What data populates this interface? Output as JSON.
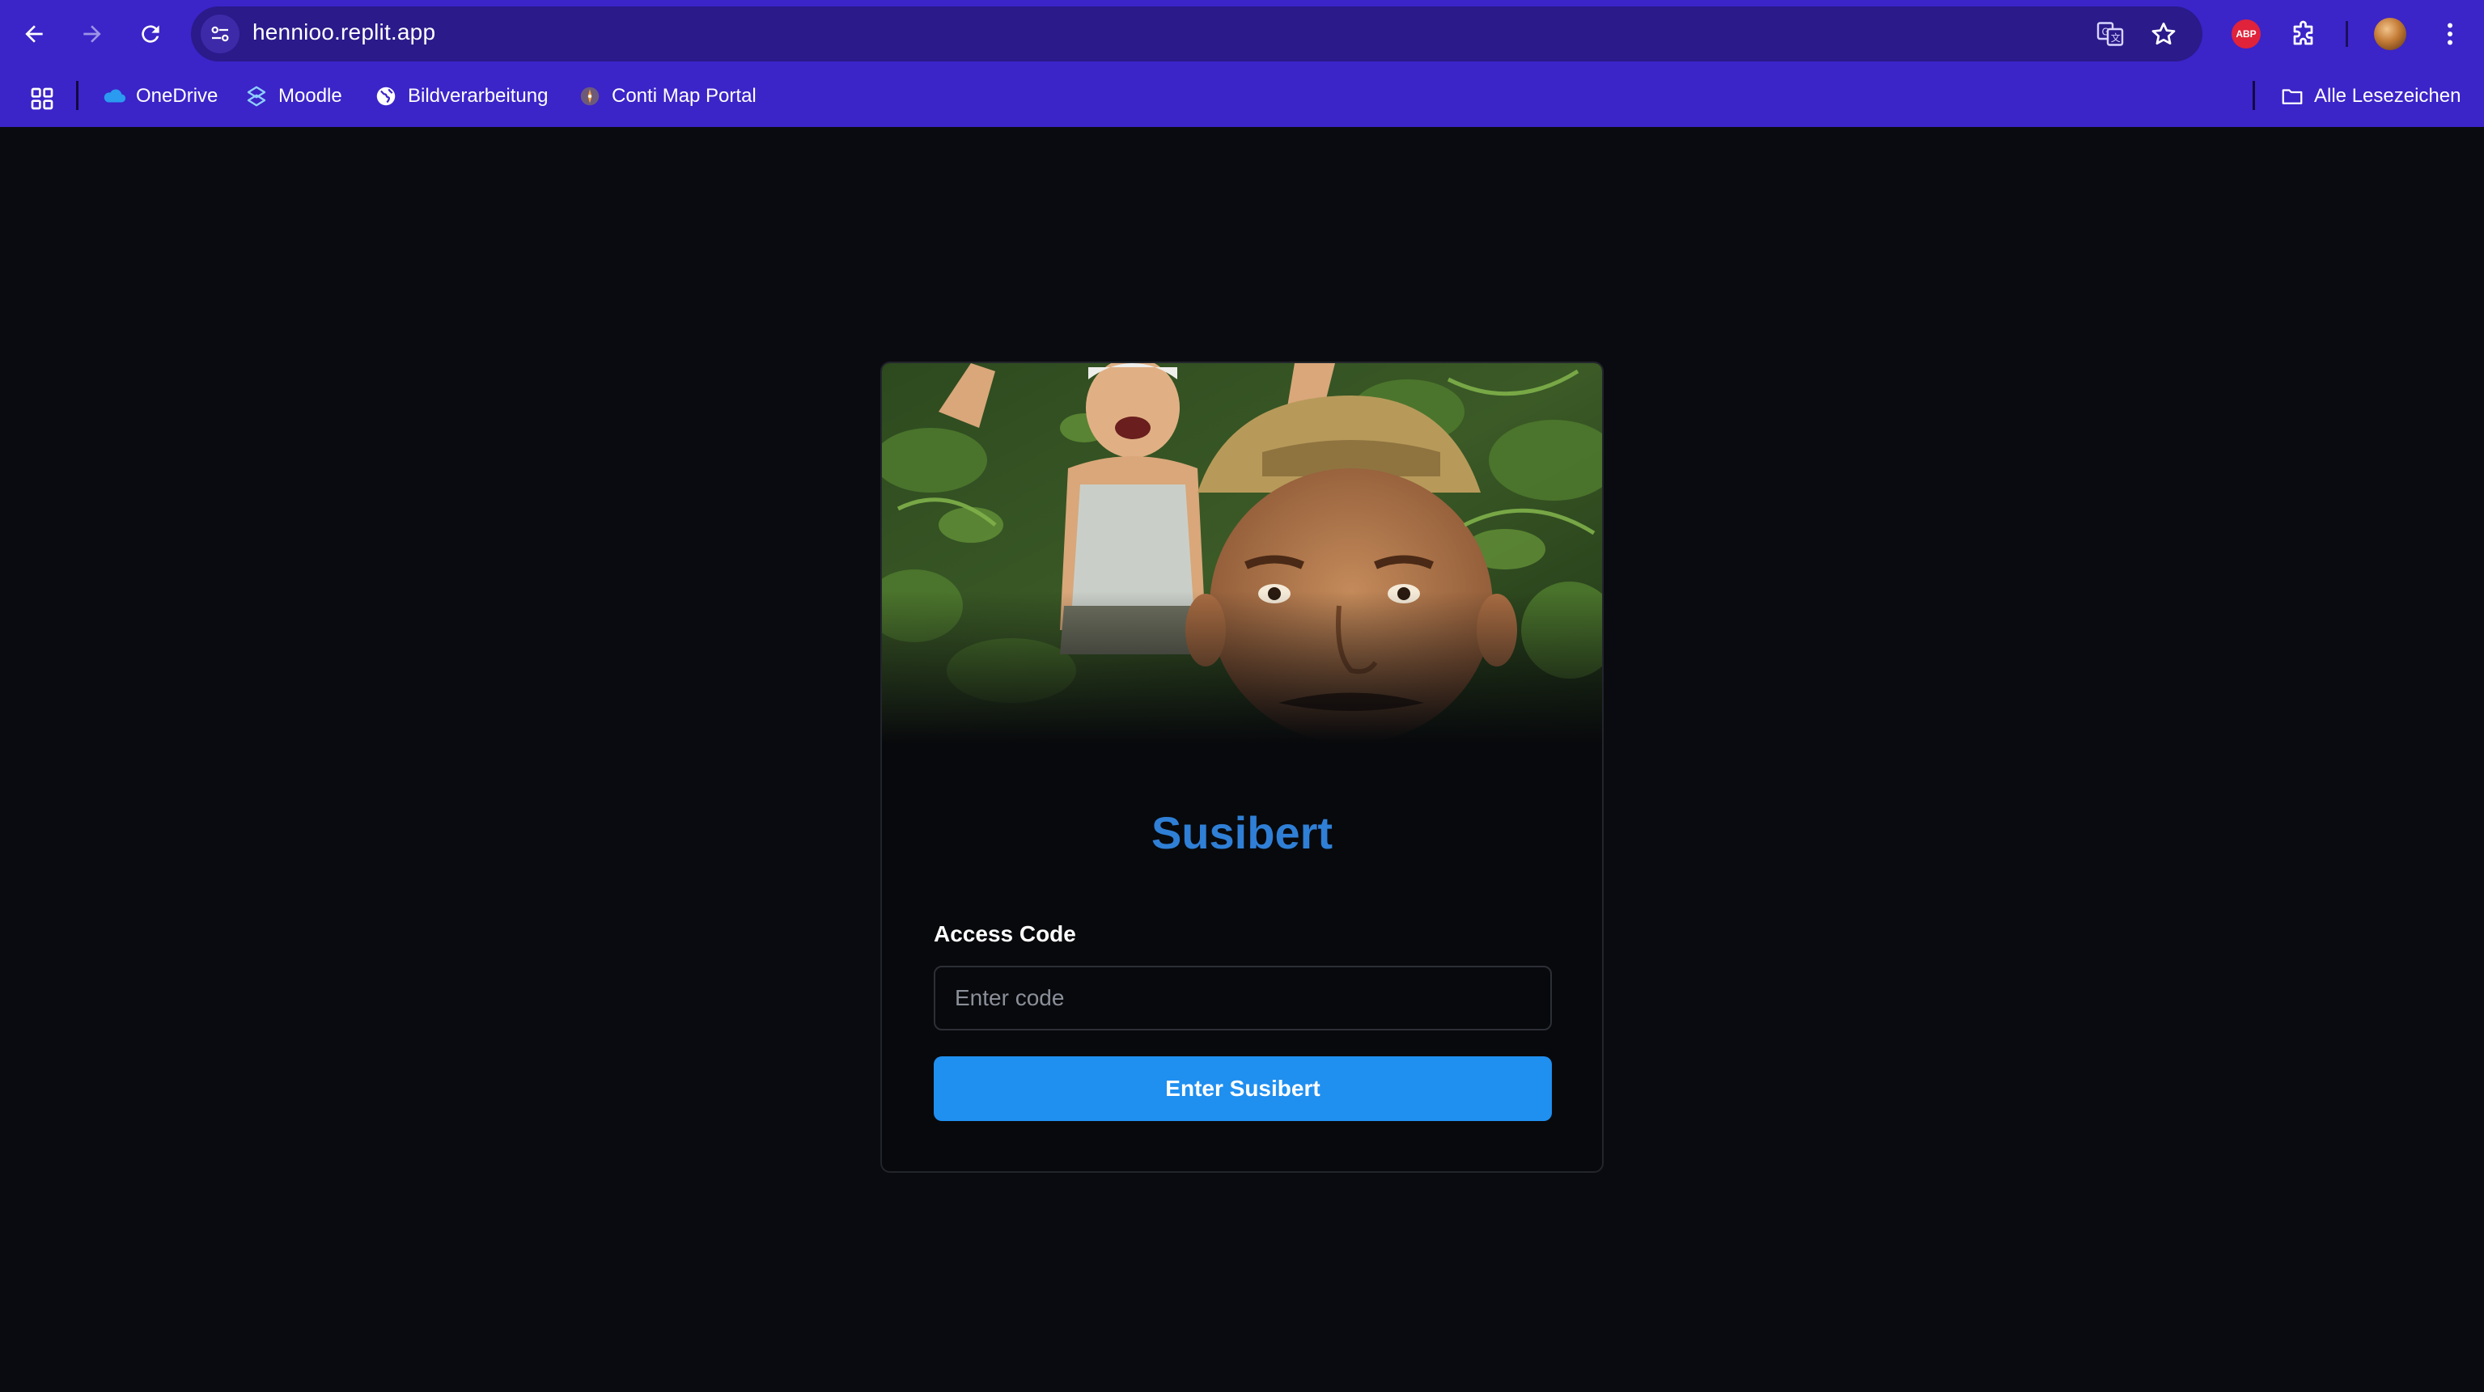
{
  "browser": {
    "url": "hennioo.replit.app",
    "nav": {
      "back_icon": "back-arrow-icon",
      "forward_icon": "forward-arrow-icon",
      "reload_icon": "reload-icon"
    },
    "extensions": {
      "abp_label": "ABP"
    },
    "bookmarks": [
      {
        "label": "OneDrive",
        "icon": "onedrive-icon"
      },
      {
        "label": "Moodle",
        "icon": "moodle-icon"
      },
      {
        "label": "Bildverarbeitung",
        "icon": "globe-icon"
      },
      {
        "label": "Conti Map Portal",
        "icon": "map-portal-icon"
      }
    ],
    "all_bookmarks_label": "Alle Lesezeichen",
    "colors": {
      "chrome": "#3b24c8",
      "omnibox": "#2a1a8a"
    }
  },
  "login": {
    "title": "Susibert",
    "access_code_label": "Access Code",
    "code_placeholder": "Enter code",
    "code_value": "",
    "submit_label": "Enter Susibert",
    "colors": {
      "title": "#2f7fd6",
      "button": "#1f8ff0",
      "background": "#0a0b10"
    }
  }
}
